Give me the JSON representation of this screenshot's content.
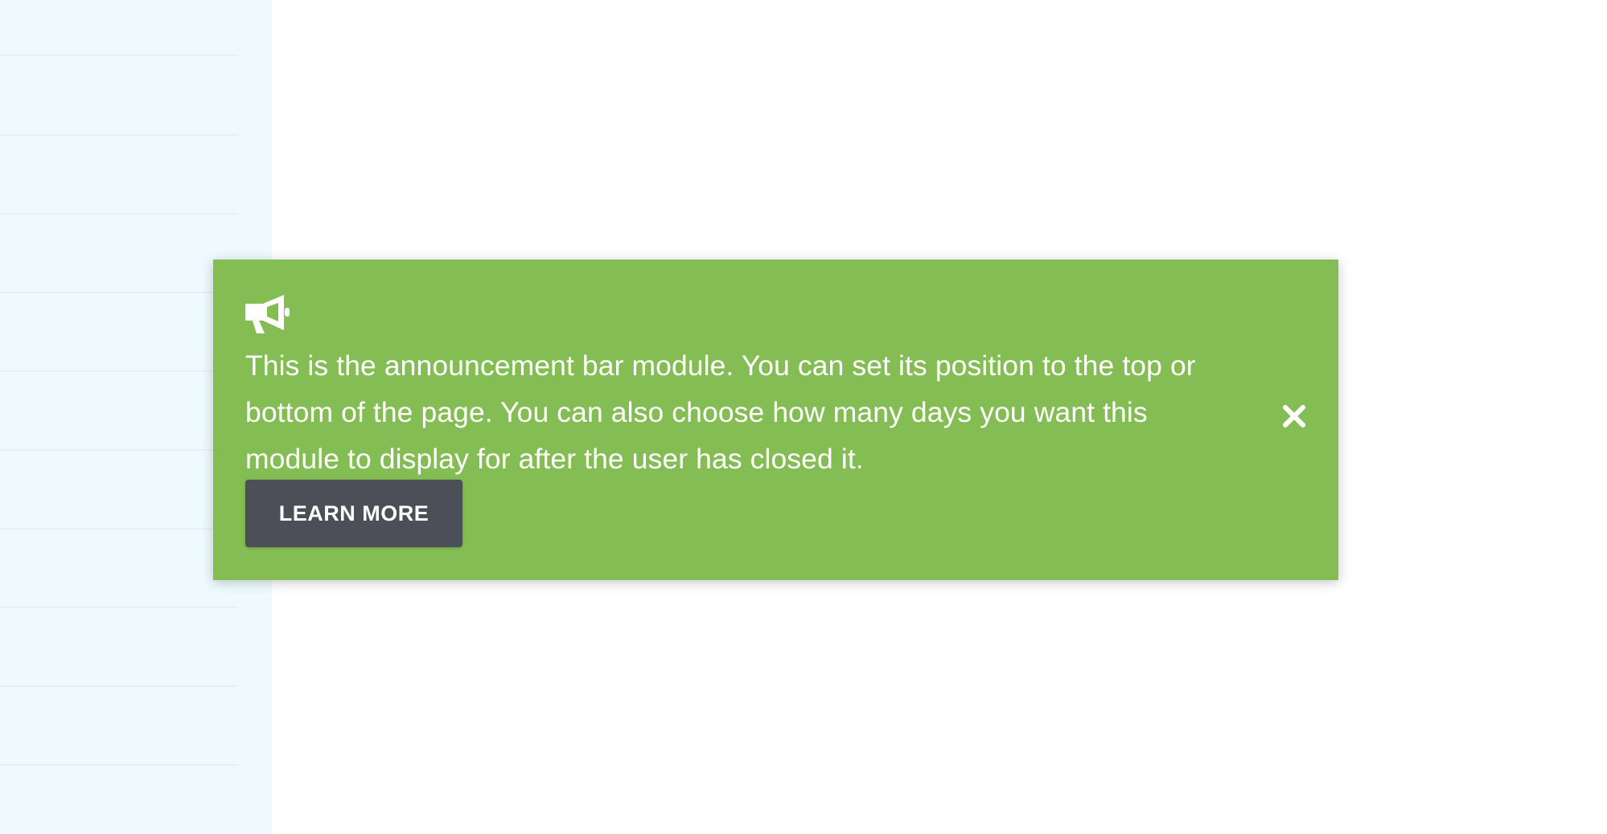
{
  "announcement": {
    "message": "This is the announcement bar module. You can set its position to the top or bottom of the page. You can also choose how many days you want this module to display for after the user has closed it.",
    "button_label": "LEARN MORE",
    "icon": "megaphone-icon",
    "close_icon": "close-icon"
  },
  "colors": {
    "bar_background": "#85bd55",
    "button_background": "#4c4f58",
    "text": "#ffffff",
    "sidebar_background": "#eefaff"
  }
}
